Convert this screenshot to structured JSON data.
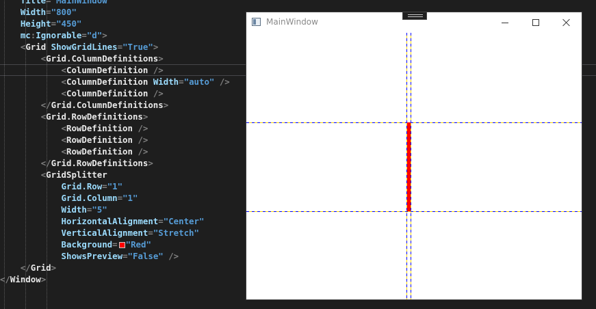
{
  "code_lines": [
    "    Title=\"MainWindow\"",
    "    Width=\"800\"",
    "    Height=\"450\"",
    "    mc:Ignorable=\"d\">",
    "    <Grid ShowGridLines=\"True\">",
    "        <Grid.ColumnDefinitions>",
    "            <ColumnDefinition />",
    "            <ColumnDefinition Width=\"auto\" />",
    "            <ColumnDefinition />",
    "        </Grid.ColumnDefinitions>",
    "        <Grid.RowDefinitions>",
    "            <RowDefinition />",
    "            <RowDefinition />",
    "            <RowDefinition />",
    "        </Grid.RowDefinitions>",
    "        <GridSplitter",
    "            Grid.Row=\"1\"",
    "            Grid.Column=\"1\"",
    "            Width=\"5\"",
    "            HorizontalAlignment=\"Center\"",
    "            VerticalAlignment=\"Stretch\"",
    "            Background=\"Red\"",
    "            ShowsPreview=\"False\" />",
    "    </Grid>",
    "</Window>"
  ],
  "current_line_index": 6,
  "swatch_color": "#ff0000",
  "window": {
    "title": "MainWindow",
    "icons": {
      "app": "window-app-icon",
      "minimize": "minimize-icon",
      "maximize": "maximize-icon",
      "close": "close-icon",
      "handle": "grab-handle-icon"
    }
  },
  "grid": {
    "show_grid_lines": true,
    "gridline_colors": [
      "#0000ff",
      "#ffd800"
    ],
    "splitter_color": "#ff0000"
  }
}
